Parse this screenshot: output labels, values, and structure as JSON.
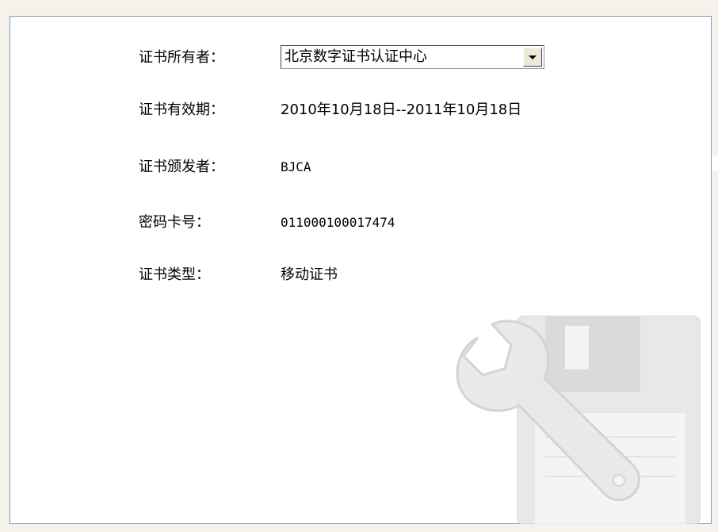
{
  "certificate": {
    "owner_label": "证书所有者：",
    "owner_selected": "北京数字证书认证中心",
    "validity_label": "证书有效期：",
    "validity_value": "2010年10月18日--2011年10月18日",
    "issuer_label": "证书颁发者：",
    "issuer_value": "BJCA",
    "card_number_label": "密码卡号：",
    "card_number_value": "011000100017474",
    "type_label": "证书类型：",
    "type_value": "移动证书"
  },
  "icons": {
    "dropdown": "chevron-down-icon",
    "watermark": "wrench-floppy-disk-icon"
  },
  "colors": {
    "panel_border": "#7f9db9",
    "page_background": "#f4f2ea"
  }
}
